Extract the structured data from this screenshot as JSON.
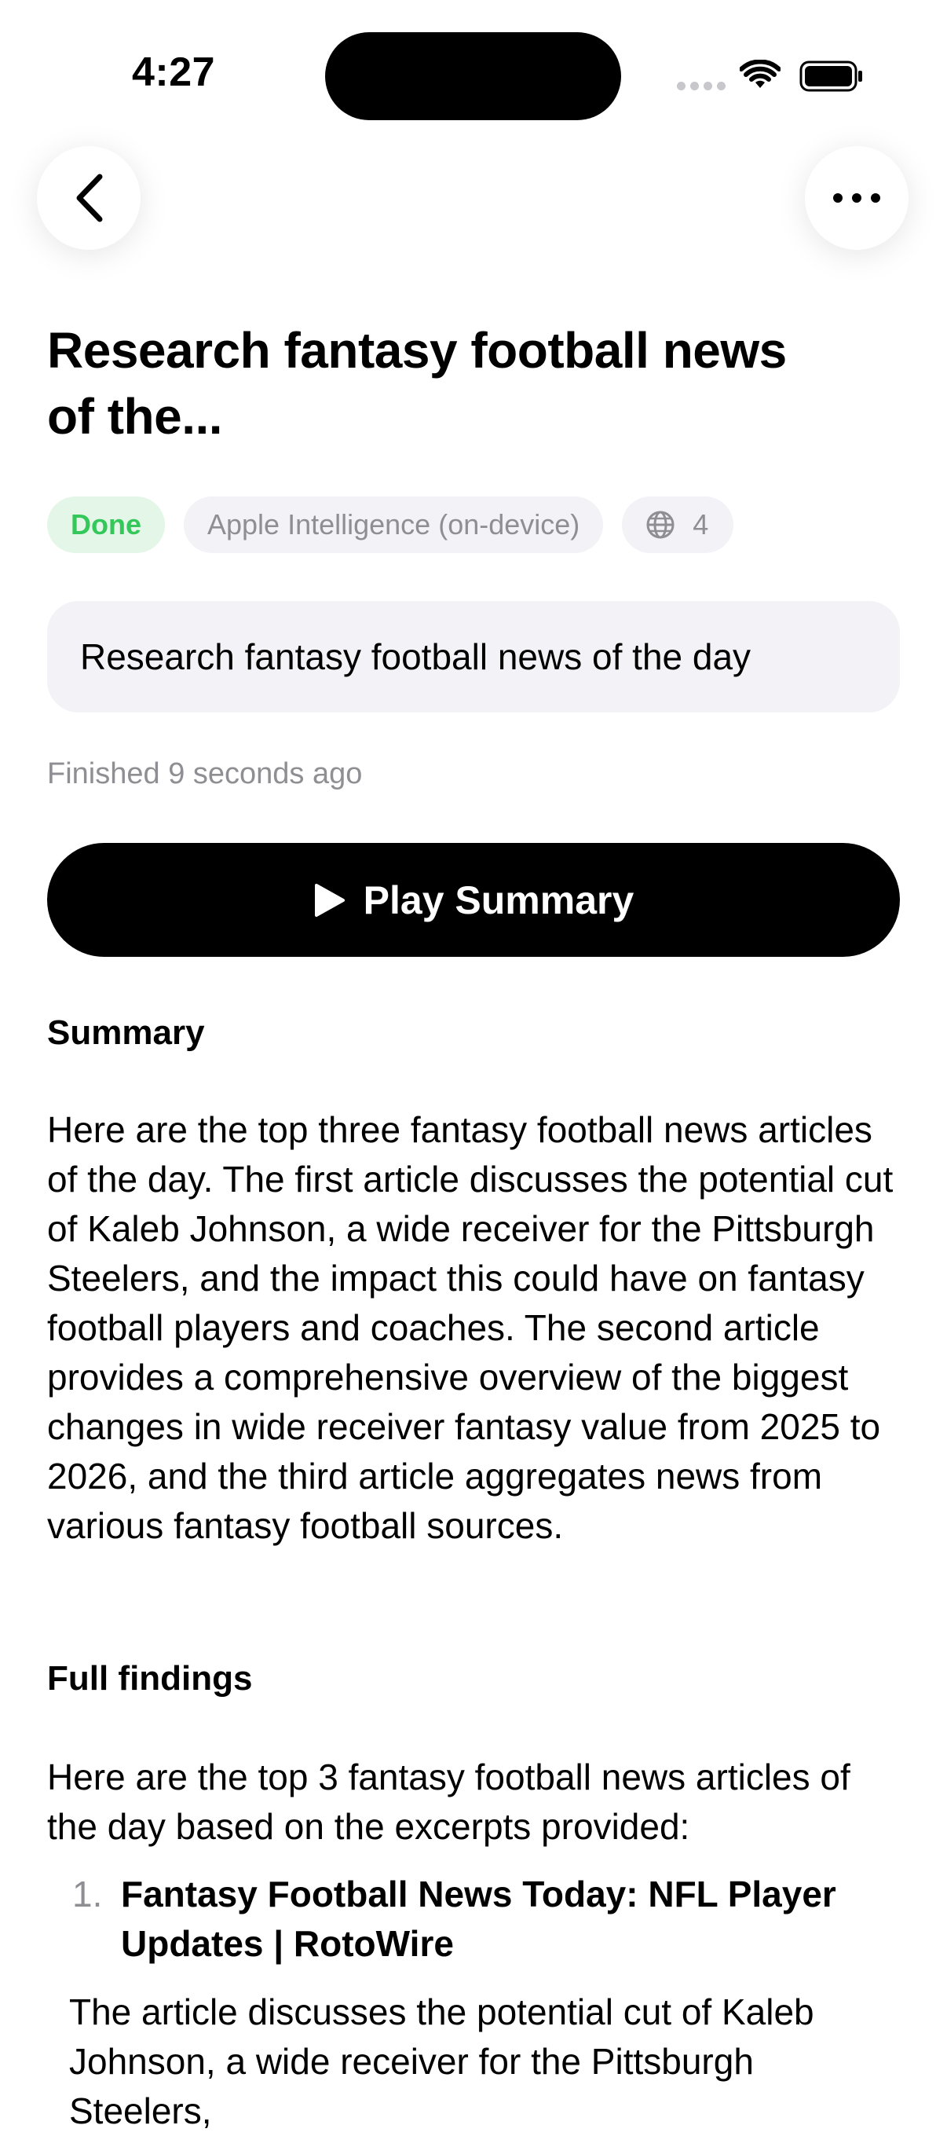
{
  "status_bar": {
    "time": "4:27",
    "icons": [
      "cellular-signal-icon",
      "wifi-icon",
      "battery-icon"
    ]
  },
  "nav": {
    "back_icon": "chevron-left-icon",
    "more_icon": "ellipsis-icon"
  },
  "task": {
    "title": "Research fantasy football news of the...",
    "status_chip": "Done",
    "model_chip": "Apple Intelligence (on-device)",
    "sources_icon": "globe-icon",
    "sources_count": "4",
    "prompt": "Research fantasy football news of the day",
    "finished": "Finished 9 seconds ago"
  },
  "actions": {
    "play_icon": "play-icon",
    "play_label": "Play Summary"
  },
  "summary": {
    "heading": "Summary",
    "text": "Here are the top three fantasy football news articles of the day. The first article discusses the potential cut of Kaleb Johnson, a wide receiver for the Pittsburgh Steelers, and the impact this could have on fantasy football players and coaches. The second article provides a comprehensive overview of the biggest changes in wide receiver fantasy value from 2025 to 2026, and the third article aggregates news from various fantasy football sources."
  },
  "findings": {
    "heading": "Full findings",
    "intro": "Here are the top 3 fantasy football news articles of the day based on the excerpts provided:",
    "items": [
      {
        "number": "1.",
        "title": "Fantasy Football News Today: NFL Player Updates | RotoWire",
        "detail": "The article discusses the potential cut of Kaleb Johnson, a wide receiver for the Pittsburgh Steelers,"
      }
    ]
  },
  "colors": {
    "done_text": "#34c759",
    "done_bg": "#e3f6e8",
    "chip_bg": "#f2f2f7",
    "secondary_text": "#8e8e93",
    "button_bg": "#000000"
  }
}
